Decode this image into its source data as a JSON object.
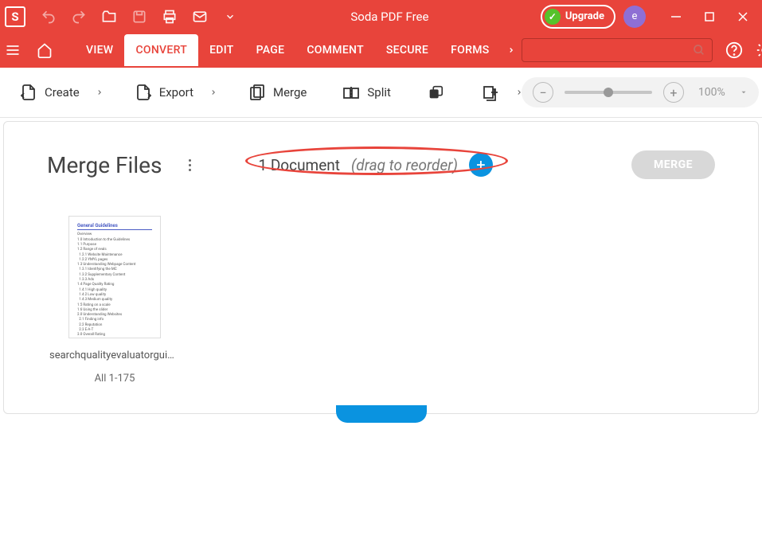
{
  "app": {
    "title": "Soda PDF Free",
    "logo_letter": "S"
  },
  "upgrade": {
    "label": "Upgrade"
  },
  "avatar": {
    "letter": "e"
  },
  "menu": {
    "tabs": [
      "VIEW",
      "CONVERT",
      "EDIT",
      "PAGE",
      "COMMENT",
      "SECURE",
      "FORMS"
    ],
    "active_index": 1
  },
  "toolbar": {
    "create": "Create",
    "export": "Export",
    "merge": "Merge",
    "split": "Split"
  },
  "zoom": {
    "value": "100%"
  },
  "merge_panel": {
    "title": "Merge Files",
    "doc_count": "1 Document",
    "hint": "(drag to reorder)",
    "merge_button": "MERGE"
  },
  "files": [
    {
      "name": "searchqualityevaluatorguide...",
      "pages": "All 1-175",
      "thumb_heading": "General Guidelines"
    }
  ]
}
